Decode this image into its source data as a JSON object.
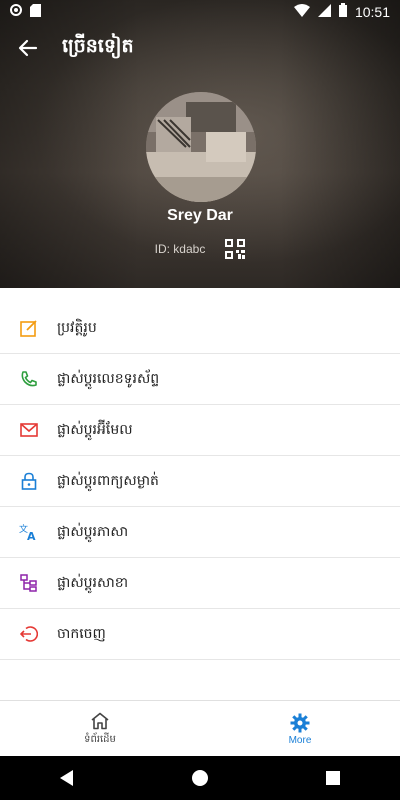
{
  "status_bar": {
    "time": "10:51",
    "icons": [
      "notification-dot-icon",
      "sd-card-icon",
      "wifi-icon",
      "signal-icon",
      "battery-icon"
    ]
  },
  "header": {
    "title": "ច្រើនទៀត",
    "user_name": "Srey Dar",
    "user_id": "ID: kdabc"
  },
  "menu": {
    "items": [
      {
        "label": "ប្រវត្តិរូប",
        "icon": "edit-icon",
        "color": "#f39c12"
      },
      {
        "label": "ផ្លាស់ប្តូរលេខទូរស័ព្ទ",
        "icon": "phone-icon",
        "color": "#2e9e3e"
      },
      {
        "label": "ផ្លាស់ប្តូរអ៊ីមែល",
        "icon": "mail-icon",
        "color": "#e53935"
      },
      {
        "label": "ផ្លាស់ប្តូរពាក្យសម្ងាត់",
        "icon": "lock-icon",
        "color": "#1a7fd6"
      },
      {
        "label": "ផ្លាស់ប្តូរភាសា",
        "icon": "translate-icon",
        "color": "#1a7fd6"
      },
      {
        "label": "ផ្លាស់ប្តូរសាខា",
        "icon": "branch-icon",
        "color": "#8e24aa"
      },
      {
        "label": "ចាកចេញ",
        "icon": "logout-icon",
        "color": "#e53935"
      }
    ]
  },
  "bottom_nav": {
    "tabs": [
      {
        "label": "ទំព័រដើម",
        "icon": "home-icon",
        "active": false
      },
      {
        "label": "More",
        "icon": "gear-icon",
        "active": true
      }
    ],
    "active_color": "#1a7fd6"
  }
}
